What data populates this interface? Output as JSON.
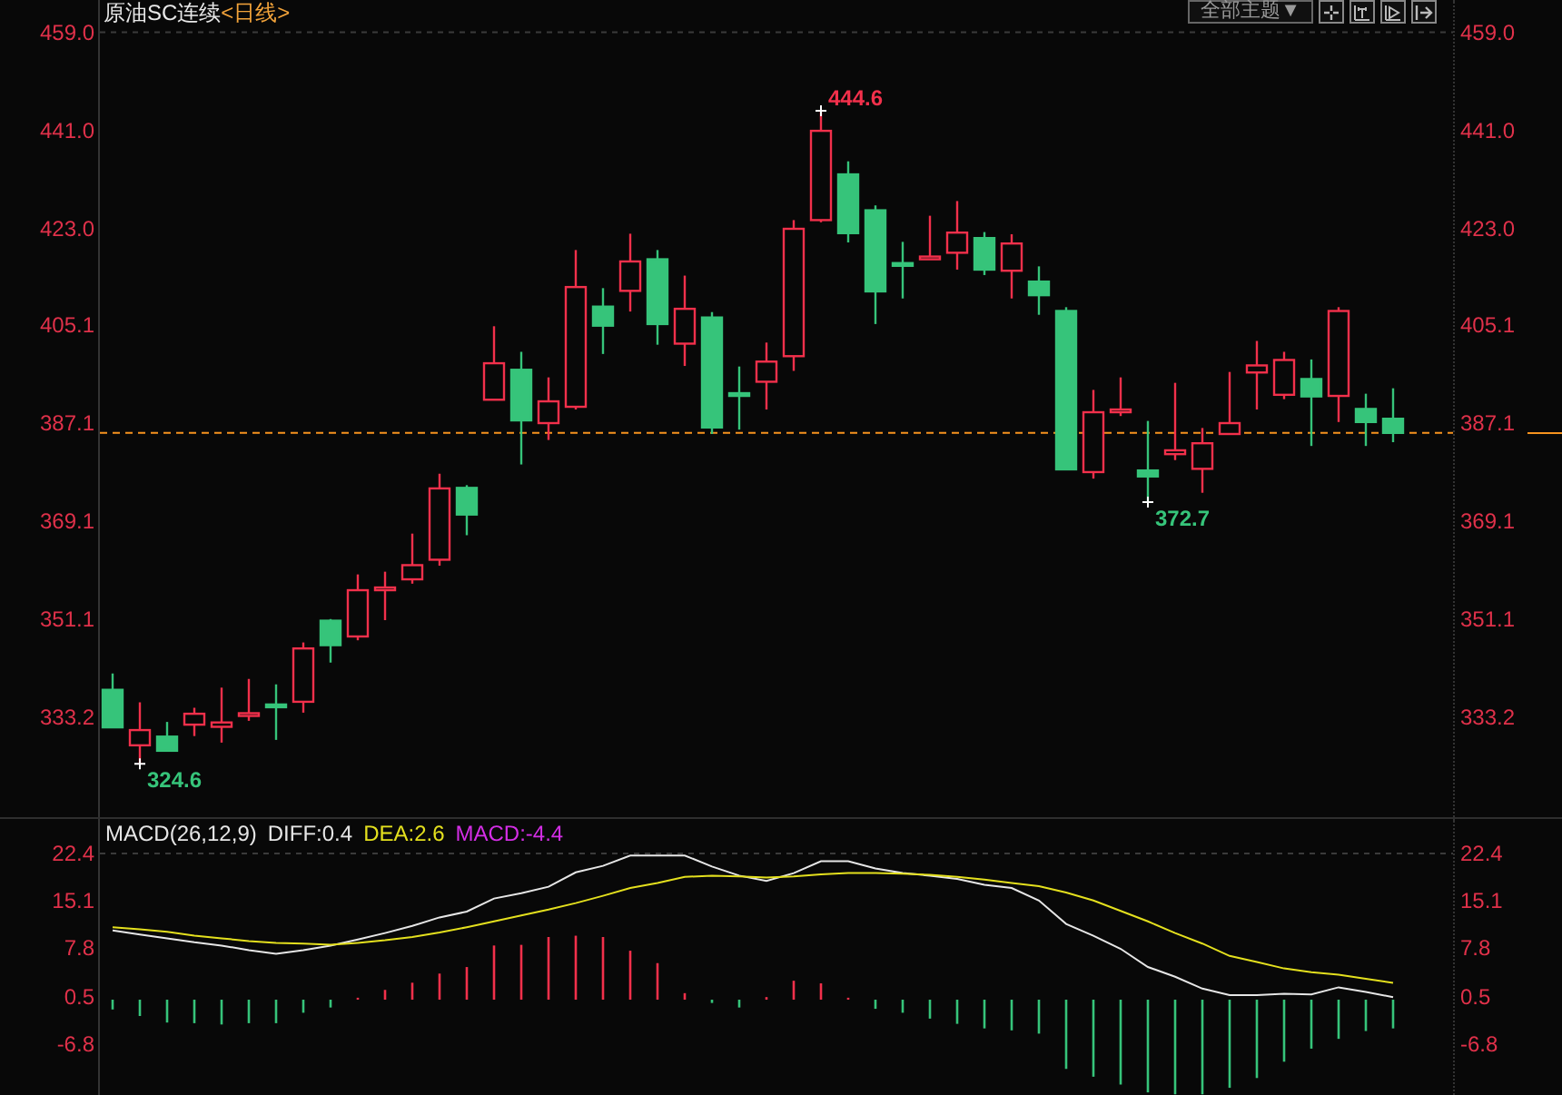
{
  "price_panel": {
    "title": {
      "symbol": "原油SC连续",
      "period": "<日线>"
    },
    "toolbar": {
      "theme_dropdown": "全部主题▼",
      "buttons": [
        {
          "kind": "crosshair"
        },
        {
          "kind": "left-bar"
        },
        {
          "kind": "play"
        },
        {
          "kind": "exit"
        }
      ]
    },
    "chart_data": {
      "type": "candlestick",
      "ylim": [
        314.8,
        459.6
      ],
      "yticks": [
        {
          "value": 459.0,
          "label": "459.0"
        },
        {
          "value": 441.0,
          "label": "441.0"
        },
        {
          "value": 423.0,
          "label": "423.0"
        },
        {
          "value": 405.1,
          "label": "405.1"
        },
        {
          "value": 387.1,
          "label": "387.1"
        },
        {
          "value": 369.1,
          "label": "369.1"
        },
        {
          "value": 351.1,
          "label": "351.1"
        },
        {
          "value": 333.2,
          "label": "333.2"
        }
      ],
      "ohlc": [
        [
          338.2,
          341.2,
          331.3,
          331.3
        ],
        [
          328.0,
          335.9,
          324.6,
          330.8
        ],
        [
          329.6,
          332.3,
          327.0,
          327.0
        ],
        [
          331.8,
          334.9,
          329.7,
          333.8
        ],
        [
          331.4,
          338.6,
          328.5,
          332.2
        ],
        [
          333.7,
          340.2,
          332.5,
          333.9
        ],
        [
          335.5,
          339.2,
          329.0,
          335.3
        ],
        [
          336.0,
          346.9,
          334.0,
          345.8
        ],
        [
          350.9,
          351.2,
          343.2,
          346.4
        ],
        [
          348.0,
          359.4,
          347.3,
          356.5
        ],
        [
          356.8,
          359.9,
          351.0,
          357.0
        ],
        [
          358.5,
          366.9,
          357.7,
          361.1
        ],
        [
          362.1,
          377.9,
          361.0,
          375.2
        ],
        [
          375.3,
          375.8,
          366.6,
          370.4
        ],
        [
          391.5,
          405.0,
          391.5,
          398.2
        ],
        [
          397.0,
          400.3,
          379.6,
          387.7
        ],
        [
          387.2,
          395.6,
          384.1,
          391.2
        ],
        [
          390.2,
          419.0,
          389.7,
          412.2
        ],
        [
          408.6,
          412.0,
          399.9,
          405.1
        ],
        [
          411.5,
          422.0,
          407.7,
          416.9
        ],
        [
          417.3,
          419.0,
          401.6,
          405.4
        ],
        [
          401.8,
          414.3,
          397.7,
          408.2
        ],
        [
          406.6,
          407.6,
          385.2,
          386.4
        ],
        [
          392.7,
          397.6,
          386.0,
          392.3
        ],
        [
          394.8,
          402.0,
          389.7,
          398.5
        ],
        [
          399.5,
          424.5,
          396.8,
          422.9
        ],
        [
          424.5,
          444.6,
          424.1,
          440.9
        ],
        [
          432.9,
          435.3,
          420.4,
          422.1
        ],
        [
          426.3,
          427.2,
          405.4,
          411.4
        ],
        [
          416.6,
          420.5,
          410.1,
          416.1
        ],
        [
          417.6,
          425.3,
          417.6,
          417.8
        ],
        [
          418.5,
          428.0,
          415.4,
          422.2
        ],
        [
          421.2,
          422.3,
          414.4,
          415.4
        ],
        [
          415.2,
          421.9,
          410.1,
          420.2
        ],
        [
          413.2,
          416.0,
          407.1,
          410.7
        ],
        [
          407.8,
          408.5,
          378.7,
          378.7
        ],
        [
          378.2,
          393.3,
          377.0,
          389.2
        ],
        [
          389.5,
          395.6,
          388.5,
          389.7
        ],
        [
          378.5,
          387.6,
          372.7,
          377.4
        ],
        [
          381.5,
          394.6,
          380.4,
          382.2
        ],
        [
          378.8,
          386.3,
          374.4,
          383.5
        ],
        [
          385.2,
          396.6,
          385.2,
          387.2
        ],
        [
          396.5,
          402.3,
          389.7,
          397.8
        ],
        [
          392.4,
          400.3,
          391.6,
          398.8
        ],
        [
          395.3,
          398.9,
          383.0,
          392.1
        ],
        [
          392.2,
          408.5,
          387.4,
          407.8
        ],
        [
          389.8,
          392.6,
          383.0,
          387.4
        ],
        [
          388.0,
          393.6,
          383.7,
          385.4
        ]
      ],
      "annotations": [
        "444.6",
        "324.6",
        "372.7"
      ],
      "ref_lines": [
        {
          "axis": "y",
          "value": 385.4
        }
      ]
    }
  },
  "macd_panel": {
    "legend": [
      {
        "label": "MACD(26,12,9)",
        "color": "#e6e6e6"
      },
      {
        "label": "DIFF:0.4",
        "color": "#e6e6e6"
      },
      {
        "label": "DEA:2.6",
        "color": "#e4e01e"
      },
      {
        "label": "MACD:-4.4",
        "color": "#d42ee6"
      }
    ],
    "chart_data": {
      "type": "line",
      "ylim": [
        -14.6,
        22.95
      ],
      "yticks": [
        {
          "value": 22.4,
          "label": "22.4"
        },
        {
          "value": 15.1,
          "label": "15.1"
        },
        {
          "value": 7.8,
          "label": "7.8"
        },
        {
          "value": 0.5,
          "label": "0.5"
        },
        {
          "value": -6.8,
          "label": "-6.8"
        }
      ],
      "series": [
        {
          "color": "#e6e6e6",
          "values": [
            10.6,
            10.0,
            9.4,
            8.8,
            8.3,
            7.6,
            7.0,
            7.6,
            8.3,
            9.2,
            10.2,
            11.3,
            12.6,
            13.5,
            15.5,
            16.3,
            17.3,
            19.5,
            20.5,
            22.1,
            22.1,
            22.1,
            20.4,
            19.0,
            18.2,
            19.4,
            21.2,
            21.2,
            20.1,
            19.4,
            19.0,
            18.5,
            17.6,
            17.1,
            15.2,
            11.6,
            9.8,
            7.8,
            5.0,
            3.5,
            1.7,
            0.7,
            0.7,
            0.9,
            0.8,
            1.9,
            1.2,
            0.4
          ]
        },
        {
          "color": "#e4e01e",
          "values": [
            11.1,
            10.8,
            10.4,
            9.8,
            9.4,
            9.0,
            8.7,
            8.6,
            8.4,
            8.7,
            9.1,
            9.6,
            10.3,
            11.1,
            12.0,
            12.9,
            13.8,
            14.8,
            15.9,
            17.1,
            17.9,
            18.8,
            19.0,
            18.9,
            18.7,
            18.9,
            19.2,
            19.4,
            19.4,
            19.3,
            19.1,
            18.8,
            18.4,
            17.9,
            17.4,
            16.4,
            15.2,
            13.6,
            12.0,
            10.2,
            8.6,
            6.7,
            5.8,
            4.8,
            4.2,
            3.8,
            3.2,
            2.6
          ]
        },
        {
          "type": "bar",
          "colors": [
            "#36c47a",
            "#36c47a",
            "#36c47a",
            "#36c47a",
            "#36c47a",
            "#36c47a",
            "#36c47a",
            "#36c47a",
            "#36c47a",
            "#f2304b",
            "#f2304b",
            "#f2304b",
            "#f2304b",
            "#f2304b",
            "#f2304b",
            "#f2304b",
            "#f2304b",
            "#f2304b",
            "#f2304b",
            "#f2304b",
            "#f2304b",
            "#f2304b",
            "#36c47a",
            "#36c47a",
            "#f2304b",
            "#f2304b",
            "#f2304b",
            "#f2304b",
            "#36c47a",
            "#36c47a",
            "#36c47a",
            "#36c47a",
            "#36c47a",
            "#36c47a",
            "#36c47a",
            "#36c47a",
            "#36c47a",
            "#36c47a",
            "#36c47a",
            "#36c47a",
            "#36c47a",
            "#36c47a",
            "#36c47a",
            "#36c47a",
            "#36c47a",
            "#36c47a",
            "#36c47a",
            "#36c47a"
          ],
          "values": [
            -1.5,
            -2.5,
            -3.5,
            -3.6,
            -3.8,
            -3.6,
            -3.6,
            -2.0,
            -1.2,
            0.3,
            1.5,
            2.6,
            4.0,
            5.0,
            8.3,
            8.4,
            9.6,
            9.8,
            9.6,
            7.5,
            5.6,
            1.0,
            -0.5,
            -1.2,
            0.4,
            2.9,
            2.5,
            0.3,
            -1.4,
            -2.0,
            -2.9,
            -3.7,
            -4.4,
            -4.7,
            -5.2,
            -10.6,
            -11.8,
            -13.0,
            -14.2,
            -14.5,
            -14.5,
            -13.5,
            -12.0,
            -9.5,
            -7.5,
            -6.0,
            -4.8,
            -4.4
          ]
        }
      ]
    }
  }
}
